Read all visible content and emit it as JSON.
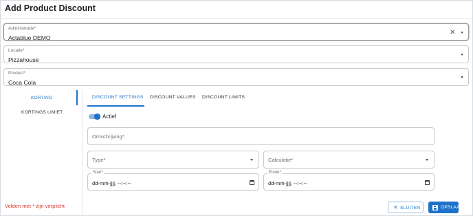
{
  "dialog": {
    "title": "Add Product Discount"
  },
  "fields": {
    "administratie": {
      "label": "Administratie*",
      "value": "Actablue DEMO",
      "clear_icon": "close-icon"
    },
    "locatie": {
      "label": "Locatie*",
      "value": "Pizzahouse"
    },
    "product": {
      "label": "Product*",
      "value": "Coca Cola"
    }
  },
  "side_tabs": [
    {
      "label": "KORTING",
      "active": true
    },
    {
      "label": "KORTINGS LIMIET",
      "active": false
    }
  ],
  "tabs": [
    {
      "label": "DISCOUNT SETTINGS",
      "active": true
    },
    {
      "label": "DISCOUNT VALUES",
      "active": false
    },
    {
      "label": "DISCOUNT LIMITS",
      "active": false
    }
  ],
  "form": {
    "toggle": {
      "label": "Actief",
      "checked": true
    },
    "omschrijving": {
      "placeholder": "Omschrijving*"
    },
    "type": {
      "placeholder": "Type*"
    },
    "calculatie": {
      "placeholder": "Calculatie*"
    },
    "start": {
      "label": "Start*",
      "value": "dd-mm-jjjj, --:--:--"
    },
    "einde": {
      "label": "Einde*",
      "value": "dd-mm-jjjj, --:--:--"
    }
  },
  "footer": {
    "required_note": "Velden met * zijn verplicht",
    "close_label": "SLUITEN",
    "save_label": "OPSLAAN"
  },
  "colors": {
    "accent": "#1e73c8",
    "error": "#d93c2e"
  }
}
